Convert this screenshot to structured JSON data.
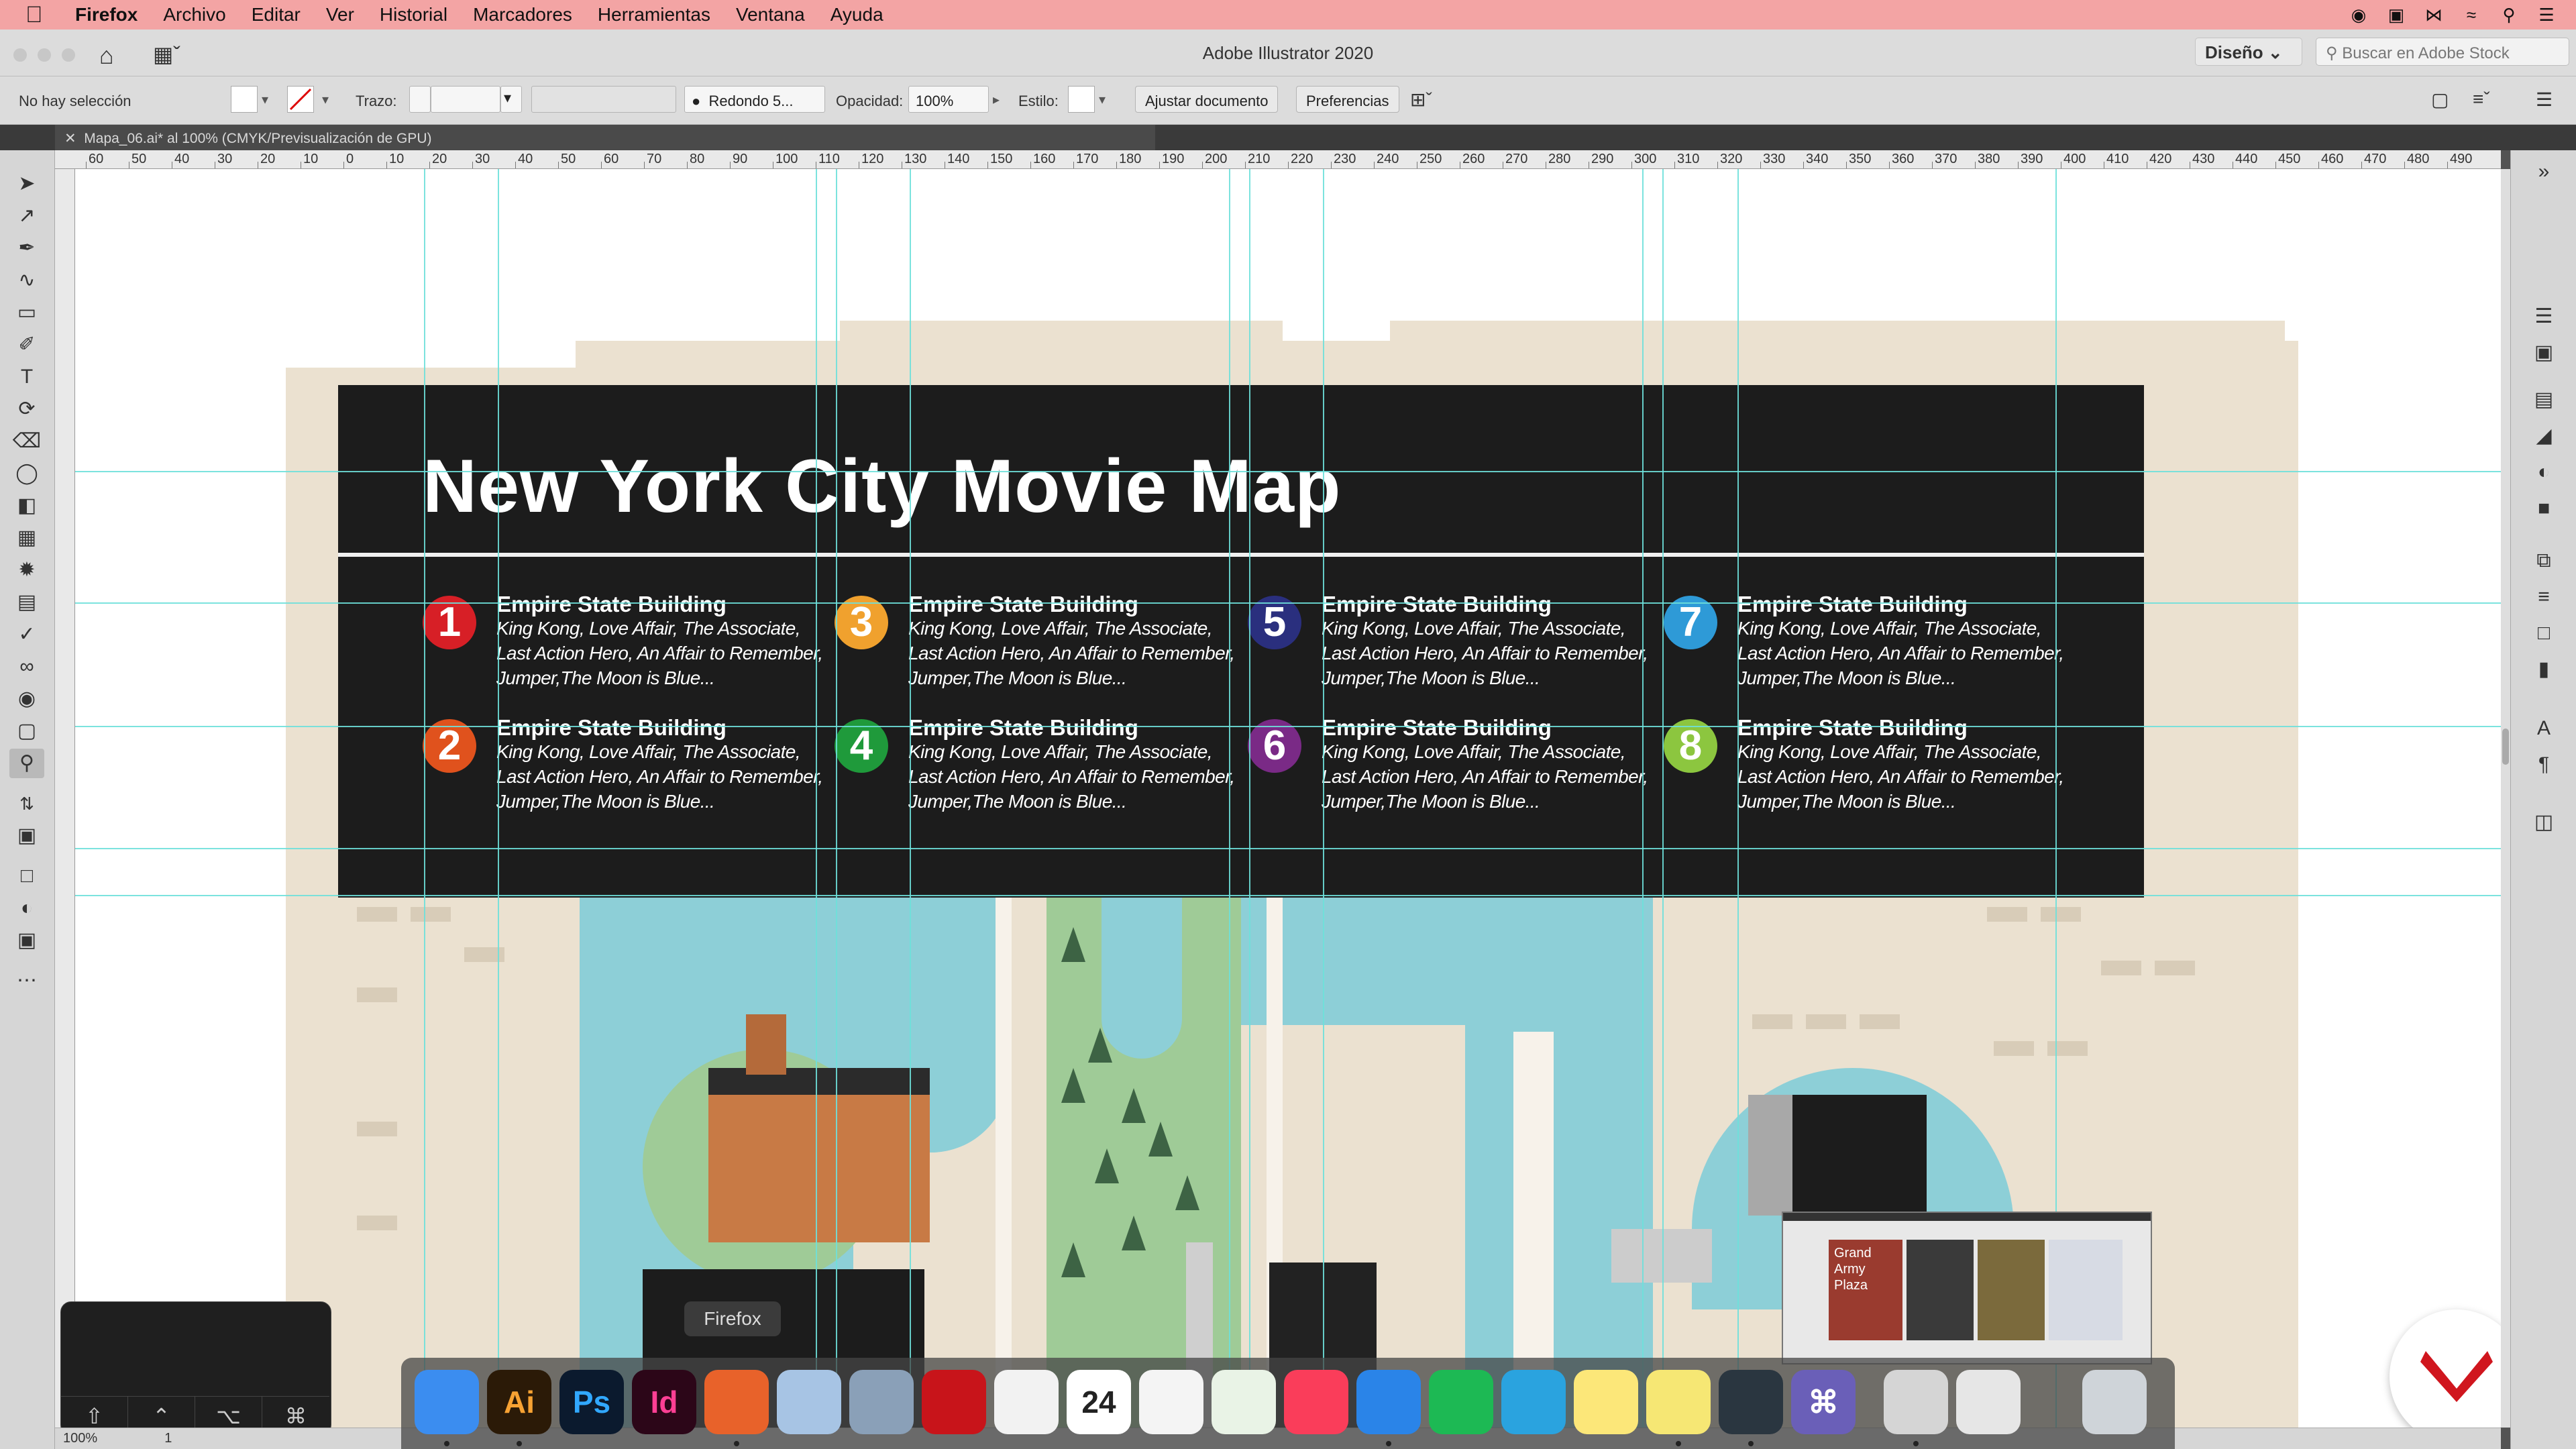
{
  "menubar": {
    "apple_icon": "apple-icon",
    "app_name": "Firefox",
    "items": [
      "Archivo",
      "Editar",
      "Ver",
      "Historial",
      "Marcadores",
      "Herramientas",
      "Ventana",
      "Ayuda"
    ],
    "tray_icons": [
      "record-icon",
      "adobe-cc-icon",
      "bluetooth-icon",
      "wifi-icon",
      "search-icon",
      "control-center-icon"
    ]
  },
  "appbar": {
    "title": "Adobe Illustrator 2020",
    "workspace": "Diseño",
    "stock_placeholder": "Buscar en Adobe Stock"
  },
  "control_bar": {
    "selection": "No hay selección",
    "stroke_label": "Trazo:",
    "brush": "Redondo 5...",
    "opacity_label": "Opacidad:",
    "opacity_value": "100%",
    "style_label": "Estilo:",
    "fit_document": "Ajustar documento",
    "preferences": "Preferencias"
  },
  "document": {
    "tab_label": "Mapa_06.ai* al 100% (CMYK/Previsualización de GPU)",
    "zoom": "100%",
    "artboard": "1"
  },
  "ruler": {
    "labels": [
      "60",
      "50",
      "40",
      "30",
      "20",
      "10",
      "0",
      "10",
      "20",
      "30",
      "40",
      "50",
      "60",
      "70",
      "80",
      "90",
      "100",
      "110",
      "120",
      "130",
      "140",
      "150",
      "160",
      "170",
      "180",
      "190",
      "200",
      "210",
      "220",
      "230",
      "240",
      "250",
      "260",
      "270",
      "280",
      "290",
      "300",
      "310",
      "320",
      "330",
      "340",
      "350",
      "360",
      "370",
      "380",
      "390",
      "400",
      "410",
      "420",
      "430",
      "440",
      "450",
      "460",
      "470",
      "480",
      "490"
    ]
  },
  "map": {
    "title": "New York City Movie Map",
    "entries": [
      {
        "num": "1",
        "color": "#d71f26",
        "title": "Empire State Building",
        "films": "King Kong, Love Affair, The Associate, Last Action Hero, An Affair to Remember, Jumper,The Moon is Blue..."
      },
      {
        "num": "2",
        "color": "#e0521d",
        "title": "Empire State Building",
        "films": "King Kong, Love Affair, The Associate, Last Action Hero, An Affair to Remember, Jumper,The Moon is Blue..."
      },
      {
        "num": "3",
        "color": "#f0a12e",
        "title": "Empire State Building",
        "films": "King Kong, Love Affair, The Associate, Last Action Hero, An Affair to Remember, Jumper,The Moon is Blue..."
      },
      {
        "num": "4",
        "color": "#1f9a3b",
        "title": "Empire State Building",
        "films": "King Kong, Love Affair, The Associate, Last Action Hero, An Affair to Remember, Jumper,The Moon is Blue..."
      },
      {
        "num": "5",
        "color": "#2a2f7e",
        "title": "Empire State Building",
        "films": "King Kong, Love Affair, The Associate, Last Action Hero, An Affair to Remember, Jumper,The Moon is Blue..."
      },
      {
        "num": "6",
        "color": "#7a2a86",
        "title": "Empire State Building",
        "films": "King Kong, Love Affair, The Associate, Last Action Hero, An Affair to Remember, Jumper,The Moon is Blue..."
      },
      {
        "num": "7",
        "color": "#2e9ad7",
        "title": "Empire State Building",
        "films": "King Kong, Love Affair, The Associate, Last Action Hero, An Affair to Remember, Jumper,The Moon is Blue..."
      },
      {
        "num": "8",
        "color": "#8cc63f",
        "title": "Empire State Building",
        "films": "King Kong, Love Affair, The Associate, Last Action Hero, An Affair to Remember, Jumper,The Moon is Blue..."
      }
    ],
    "thumbnail_text": "Grand Army Plaza"
  },
  "dock": {
    "tooltip": "Firefox",
    "apps": [
      {
        "name": "Finder",
        "icon": "finder-icon",
        "label": "",
        "bg": "#3b8df0",
        "fg": "#fff"
      },
      {
        "name": "Illustrator",
        "icon": "illustrator-icon",
        "label": "Ai",
        "bg": "#2b1a07",
        "fg": "#f7a233"
      },
      {
        "name": "Photoshop",
        "icon": "photoshop-icon",
        "label": "Ps",
        "bg": "#0b1a2e",
        "fg": "#31a8ff"
      },
      {
        "name": "InDesign",
        "icon": "indesign-icon",
        "label": "Id",
        "bg": "#2c0618",
        "fg": "#ff3f94"
      },
      {
        "name": "Firefox",
        "icon": "firefox-icon",
        "label": "",
        "bg": "#e8622a",
        "fg": "#fff"
      },
      {
        "name": "Preview",
        "icon": "preview-icon",
        "label": "",
        "bg": "#a7c4e4",
        "fg": "#fff"
      },
      {
        "name": "Image Capture",
        "icon": "image-capture-icon",
        "label": "",
        "bg": "#8aa0b8",
        "fg": "#fff"
      },
      {
        "name": "Acrobat",
        "icon": "acrobat-icon",
        "label": "",
        "bg": "#c8141a",
        "fg": "#fff"
      },
      {
        "name": "TextEdit",
        "icon": "textedit-icon",
        "label": "",
        "bg": "#f2f2f2",
        "fg": "#333"
      },
      {
        "name": "Calendar",
        "icon": "calendar-icon",
        "label": "24",
        "bg": "#ffffff",
        "fg": "#222"
      },
      {
        "name": "Photos",
        "icon": "photos-icon",
        "label": "",
        "bg": "#f4f4f4",
        "fg": "#333"
      },
      {
        "name": "Numbers",
        "icon": "numbers-icon",
        "label": "",
        "bg": "#e9f3e6",
        "fg": "#1e9a3b"
      },
      {
        "name": "Music",
        "icon": "music-icon",
        "label": "",
        "bg": "#fa3d5a",
        "fg": "#fff"
      },
      {
        "name": "Keynote",
        "icon": "keynote-icon",
        "label": "",
        "bg": "#2a84e8",
        "fg": "#fff"
      },
      {
        "name": "Spotify",
        "icon": "spotify-icon",
        "label": "",
        "bg": "#1db954",
        "fg": "#111"
      },
      {
        "name": "Telegram",
        "icon": "telegram-icon",
        "label": "",
        "bg": "#2aa3df",
        "fg": "#fff"
      },
      {
        "name": "Notes",
        "icon": "notes-icon",
        "label": "",
        "bg": "#fce779",
        "fg": "#333"
      },
      {
        "name": "Stickies",
        "icon": "stickies-icon",
        "label": "",
        "bg": "#f6e774",
        "fg": "#333"
      },
      {
        "name": "QuickTime",
        "icon": "quicktime-icon",
        "label": "",
        "bg": "#2a3640",
        "fg": "#4cc3ff"
      },
      {
        "name": "Keystroke",
        "icon": "keystroke-icon",
        "label": "⌘",
        "bg": "#6a5fb8",
        "fg": "#fff"
      },
      {
        "name": "Printer",
        "icon": "printer-icon",
        "label": "",
        "bg": "#d5d5d5",
        "fg": "#333"
      },
      {
        "name": "Screenshot",
        "icon": "screenshot-icon",
        "label": "",
        "bg": "#e6e6e6",
        "fg": "#333"
      },
      {
        "name": "Trash",
        "icon": "trash-icon",
        "label": "",
        "bg": "#cfd4d9",
        "fg": "#333"
      }
    ]
  },
  "keyboard_overlay": {
    "keys": [
      "⇧",
      "⌃",
      "⌥",
      "⌘"
    ]
  }
}
